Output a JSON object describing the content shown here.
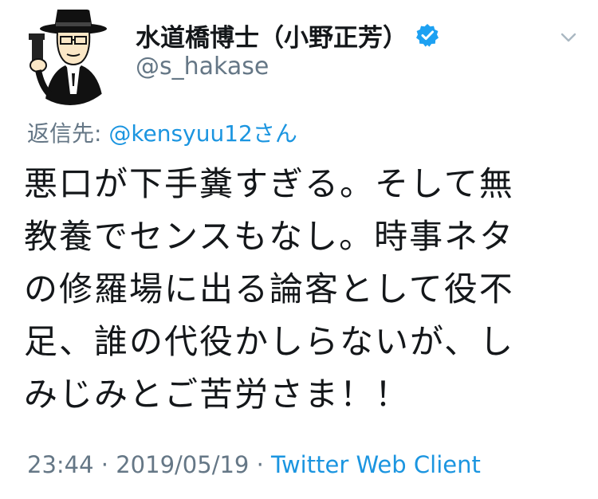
{
  "author": {
    "display_name": "水道橋博士（小野正芳）",
    "handle": "@s_hakase",
    "verified_icon": "verified-badge-icon",
    "avatar_icon": "cartoon-man-with-hat-and-gun"
  },
  "menu": {
    "caret_icon": "chevron-down-icon"
  },
  "reply": {
    "label": "返信先: ",
    "user": "@kensyuu12さん"
  },
  "tweet": {
    "lines": [
      "悪口が下手糞すぎる。そして無",
      "教養でセンスもなし。時事ネタ",
      "の修羅場に出る論客として役不",
      "足、誰の代役かしらないが、し",
      "みじみとご苦労さま！！"
    ]
  },
  "meta": {
    "time": "23:44",
    "sep1": " · ",
    "date": "2019/05/19",
    "sep2": " · ",
    "client": "Twitter Web Client"
  },
  "colors": {
    "text": "#14171a",
    "secondary": "#657786",
    "link": "#1b95e0",
    "verified": "#1da1f2"
  }
}
